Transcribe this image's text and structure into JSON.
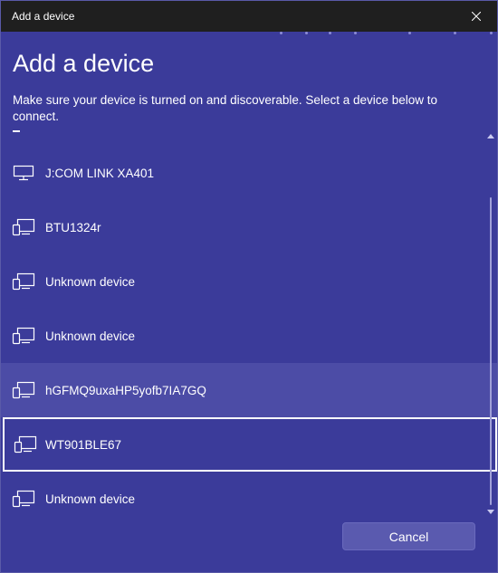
{
  "window": {
    "title": "Add a device"
  },
  "header": {
    "heading": "Add a device",
    "instructions": "Make sure your device is turned on and discoverable. Select a device below to connect."
  },
  "devices": [
    {
      "name": "J:COM LINK XA401",
      "icon": "monitor-icon",
      "state": "normal"
    },
    {
      "name": "BTU1324r",
      "icon": "devices-icon",
      "state": "normal"
    },
    {
      "name": "Unknown device",
      "icon": "devices-icon",
      "state": "normal"
    },
    {
      "name": "Unknown device",
      "icon": "devices-icon",
      "state": "normal"
    },
    {
      "name": "hGFMQ9uxaHP5yofb7IA7GQ",
      "icon": "devices-icon",
      "state": "hover"
    },
    {
      "name": "WT901BLE67",
      "icon": "devices-icon",
      "state": "selected"
    },
    {
      "name": "Unknown device",
      "icon": "devices-icon",
      "state": "normal"
    }
  ],
  "footer": {
    "cancel_label": "Cancel"
  },
  "colors": {
    "background": "#3b3b9a",
    "titlebar": "#1f1f1f",
    "hover_row": "#4c4ca6",
    "button": "#5a5aaf",
    "text": "#ffffff"
  }
}
